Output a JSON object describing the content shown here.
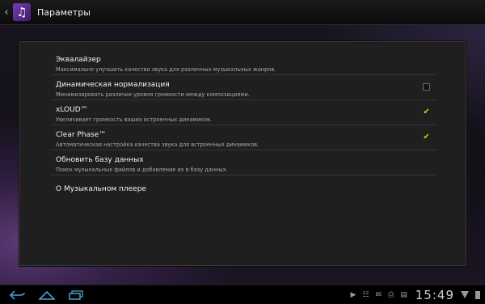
{
  "app": {
    "title": "Параметры",
    "icon": "music-note-icon"
  },
  "preferences": [
    {
      "title": "Эквалайзер",
      "summary": "Максимально улучшить качество звука для различных музыкальных жанров.",
      "checkbox": null
    },
    {
      "title": "Динамическая нормализация",
      "summary": "Минимизировать различия уровня громкости между композициями.",
      "checkbox": false
    },
    {
      "title": "xLOUD™",
      "summary": "Увеличивает громкость ваших встроенных динамиков.",
      "checkbox": true
    },
    {
      "title": "Clear Phase™",
      "summary": "Автоматическая настройка качества звука для встроенных динамиков.",
      "checkbox": true
    },
    {
      "title": "Обновить базу данных",
      "summary": "Поиск музыкальных файлов и добавление их в базу данных.",
      "checkbox": null
    },
    {
      "title": "О Музыкальном плеере",
      "summary": "",
      "checkbox": null
    }
  ],
  "statusbar": {
    "time": "15:49"
  },
  "colors": {
    "checkmark": "#b8e000",
    "nav": "#4a9fd0"
  }
}
